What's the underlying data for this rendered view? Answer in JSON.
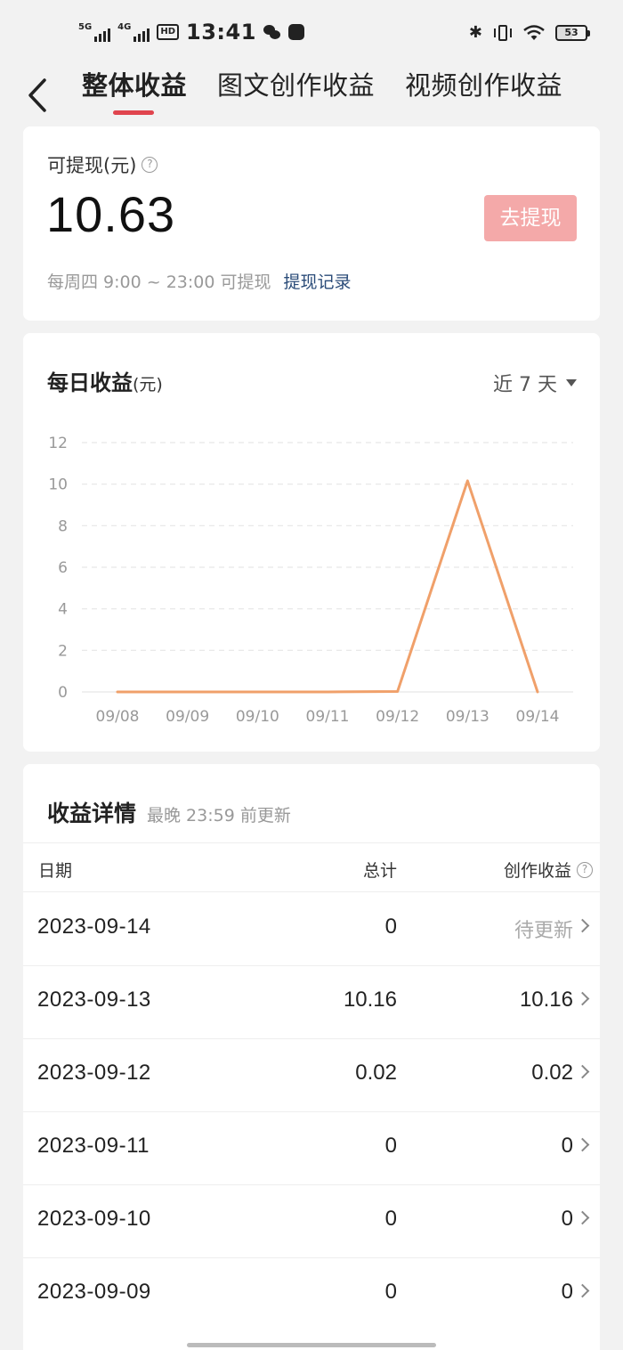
{
  "status_bar": {
    "sim1": "5G",
    "sim2": "4G",
    "hd": "HD",
    "time": "13:41",
    "battery": "53"
  },
  "header": {
    "tabs": [
      {
        "label": "整体收益",
        "active": true
      },
      {
        "label": "图文创作收益",
        "active": false
      },
      {
        "label": "视频创作收益",
        "active": false
      }
    ]
  },
  "balance": {
    "label": "可提现(元)",
    "amount": "10.63",
    "withdraw_button": "去提现",
    "note": "每周四 9:00 ~ 23:00 可提现",
    "record_link": "提现记录"
  },
  "daily_chart": {
    "title": "每日收益",
    "unit": "(元)",
    "range": "近 7 天",
    "line_color": "#f0a06a"
  },
  "chart_data": {
    "type": "line",
    "categories": [
      "09/08",
      "09/09",
      "09/10",
      "09/11",
      "09/12",
      "09/13",
      "09/14"
    ],
    "values": [
      0,
      0,
      0,
      0,
      0.02,
      10.16,
      0
    ],
    "ylim": [
      0,
      12
    ],
    "yticks": [
      0,
      2,
      4,
      6,
      8,
      10,
      12
    ],
    "grid": true
  },
  "details": {
    "title": "收益详情",
    "subtitle": "最晚 23:59 前更新",
    "columns": {
      "date": "日期",
      "total": "总计",
      "creation": "创作收益"
    },
    "rows": [
      {
        "date": "2023-09-14",
        "total": "0",
        "creation": "待更新",
        "pending": true
      },
      {
        "date": "2023-09-13",
        "total": "10.16",
        "creation": "10.16"
      },
      {
        "date": "2023-09-12",
        "total": "0.02",
        "creation": "0.02"
      },
      {
        "date": "2023-09-11",
        "total": "0",
        "creation": "0"
      },
      {
        "date": "2023-09-10",
        "total": "0",
        "creation": "0"
      },
      {
        "date": "2023-09-09",
        "total": "0",
        "creation": "0"
      }
    ]
  }
}
